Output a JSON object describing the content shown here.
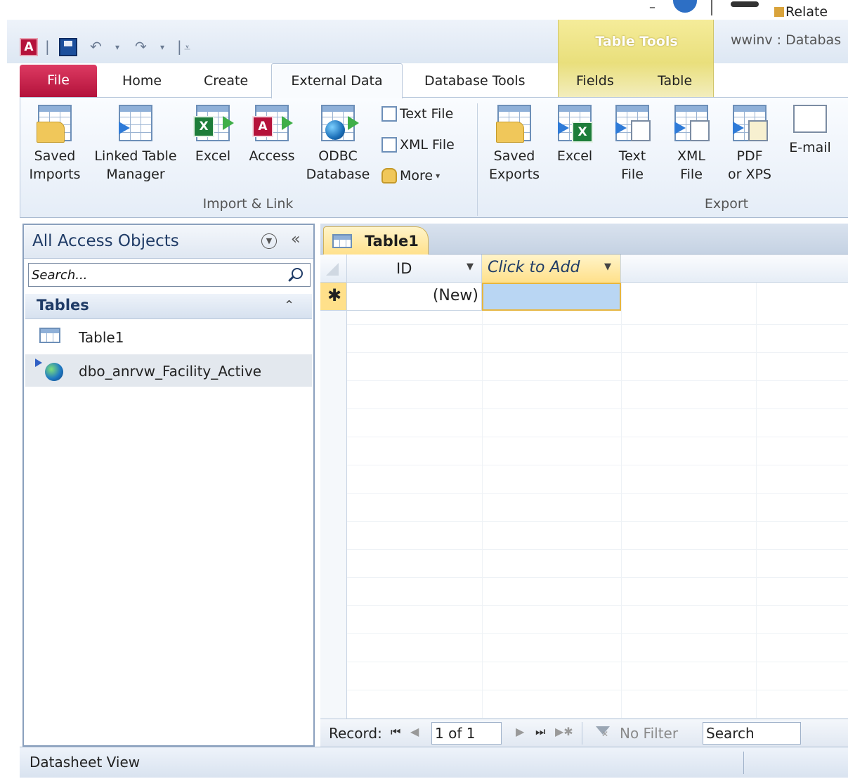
{
  "titlebar": {
    "window_title": "wwinv : Databas",
    "contextual_group": "Table Tools",
    "relate_label": "Relate",
    "colors": {
      "file_tab": "#b3123b",
      "contextual": "#e9df7c",
      "accent": "#1f3b66"
    }
  },
  "tabs": {
    "file": "File",
    "home": "Home",
    "create": "Create",
    "external_data": "External Data",
    "database_tools": "Database Tools",
    "fields": "Fields",
    "table": "Table"
  },
  "ribbon": {
    "import_group": {
      "label": "Import & Link",
      "saved_imports": [
        "Saved",
        "Imports"
      ],
      "linked_table_manager": [
        "Linked Table",
        "Manager"
      ],
      "excel": "Excel",
      "access": "Access",
      "odbc": [
        "ODBC",
        "Database"
      ],
      "text_file": "Text File",
      "xml_file": "XML File",
      "more": "More"
    },
    "export_group": {
      "label": "Export",
      "saved_exports": [
        "Saved",
        "Exports"
      ],
      "excel": "Excel",
      "text_file": [
        "Text",
        "File"
      ],
      "xml_file": [
        "XML",
        "File"
      ],
      "pdf": [
        "PDF",
        "or XPS"
      ],
      "email": "E-mail"
    }
  },
  "nav": {
    "title": "All Access Objects",
    "search_placeholder": "Search...",
    "group_label": "Tables",
    "items": [
      {
        "label": "Table1",
        "icon": "table-icon"
      },
      {
        "label": "dbo_anrvw_Facility_Active",
        "icon": "linked-odbc-table-icon"
      }
    ]
  },
  "document": {
    "tab_label": "Table1",
    "columns": [
      "ID",
      "Click to Add"
    ],
    "new_row": {
      "marker": "✱",
      "id_value": "(New)"
    }
  },
  "record_nav": {
    "label": "Record:",
    "current": "1 of 1",
    "filter_label": "No Filter",
    "search": "Search"
  },
  "status": {
    "view": "Datasheet View"
  }
}
